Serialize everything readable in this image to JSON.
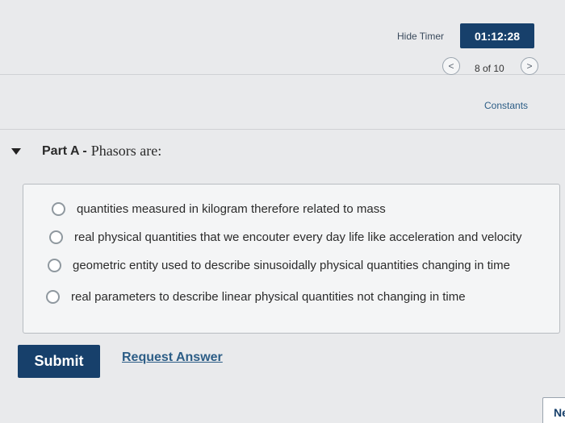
{
  "header": {
    "hide_timer_label": "Hide Timer",
    "timer_value": "01:12:28",
    "prev_symbol": "<",
    "next_symbol": ">",
    "page_count": "8 of 10",
    "constants_label": "Constants"
  },
  "part": {
    "label": "Part A -",
    "title": "Phasors are:"
  },
  "options": [
    {
      "text": "quantities measured in kilogram therefore related to mass",
      "selected": false
    },
    {
      "text": "real physical quantities that we encouter every day life like acceleration and velocity",
      "selected": false
    },
    {
      "text": "geometric entity used to describe sinusoidally physical quantities changing in time",
      "selected": false
    },
    {
      "text": "real parameters to describe linear physical quantities not changing in time",
      "selected": false
    }
  ],
  "actions": {
    "submit_label": "Submit",
    "request_answer_label": "Request Answer",
    "next_label": "Ne"
  },
  "colors": {
    "accent": "#17406b",
    "link": "#2c5d86"
  }
}
